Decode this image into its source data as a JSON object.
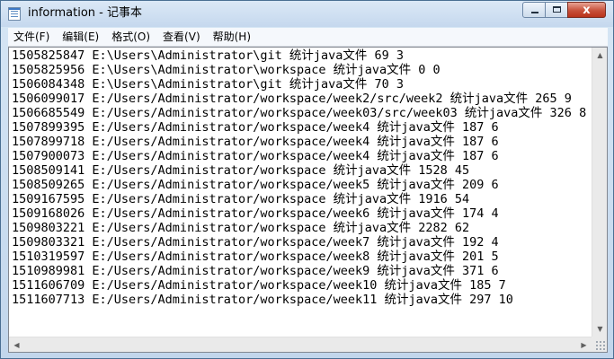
{
  "window": {
    "title": "information - 记事本",
    "minimize_glyph": "",
    "maximize_glyph": "",
    "close_glyph": "x"
  },
  "menu": {
    "items": [
      {
        "label": "文件(F)"
      },
      {
        "label": "编辑(E)"
      },
      {
        "label": "格式(O)"
      },
      {
        "label": "查看(V)"
      },
      {
        "label": "帮助(H)"
      }
    ]
  },
  "document": {
    "lines": [
      "1505825847 E:\\Users\\Administrator\\git 统计java文件 69 3",
      "1505825956 E:\\Users\\Administrator\\workspace 统计java文件 0 0",
      "1506084348 E:\\Users\\Administrator\\git 统计java文件 70 3",
      "1506099017 E:/Users/Administrator/workspace/week2/src/week2 统计java文件 265 9",
      "1506685549 E:/Users/Administrator/workspace/week03/src/week03 统计java文件 326 8",
      "1507899395 E:/Users/Administrator/workspace/week4 统计java文件 187 6",
      "1507899718 E:/Users/Administrator/workspace/week4 统计java文件 187 6",
      "1507900073 E:/Users/Administrator/workspace/week4 统计java文件 187 6",
      "1508509141 E:/Users/Administrator/workspace 统计java文件 1528 45",
      "1508509265 E:/Users/Administrator/workspace/week5 统计java文件 209 6",
      "1509167595 E:/Users/Administrator/workspace 统计java文件 1916 54",
      "1509168026 E:/Users/Administrator/workspace/week6 统计java文件 174 4",
      "1509803221 E:/Users/Administrator/workspace 统计java文件 2282 62",
      "1509803321 E:/Users/Administrator/workspace/week7 统计java文件 192 4",
      "1510319597 E:/Users/Administrator/workspace/week8 统计java文件 201 5",
      "1510989981 E:/Users/Administrator/workspace/week9 统计java文件 371 6",
      "1511606709 E:/Users/Administrator/workspace/week10 统计java文件 185 7",
      "1511607713 E:/Users/Administrator/workspace/week11 统计java文件 297 10"
    ]
  },
  "scrollbars": {
    "up_arrow": "▲",
    "down_arrow": "▼",
    "left_arrow": "◀",
    "right_arrow": "▶"
  }
}
